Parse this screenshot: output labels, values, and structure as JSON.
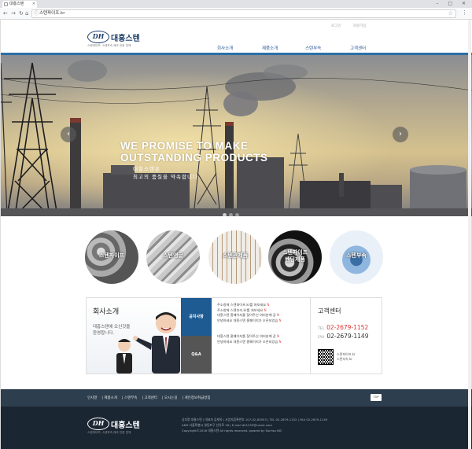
{
  "browser": {
    "tab_title": "대흥스텐",
    "url": "스텐파이프.kr",
    "window_controls": "– □ ✕"
  },
  "header": {
    "logo_mark": "DH",
    "logo_name": "대흥스텐",
    "logo_sub": "스텐파이프, 스텐부속 제조 전문 업체",
    "util_links": [
      "로그인",
      "회원가입"
    ],
    "nav": [
      "회사소개",
      "제품소개",
      "스텐부속",
      "고객센터"
    ]
  },
  "hero": {
    "title_line1": "WE PROMISE TO MAKE",
    "title_line2": "OUTSTANDING PRODUCTS",
    "sub_line1": "대흥스텐은",
    "sub_line2": "최고의 품질을 약속합니다",
    "slides": 3,
    "active_slide": 1
  },
  "categories": [
    "스텐파이프",
    "스텐앵글",
    "스텐관제품",
    "스텐파이프\n벤딩제품",
    "스텐부속"
  ],
  "about": {
    "title": "회사소개",
    "text_line1": "대흥스텐에 오신것을",
    "text_line2": "환영합니다."
  },
  "notice": {
    "tab_notice": "공지사항",
    "tab_qna": "Q&A",
    "notice_items": [
      "주소창에 스텐파이프.kr를 쳐보세요",
      "주소창에 스텐부속.kr를 쳐보세요",
      "대흥스텐 홈페이지를 찾아주신 여러분께 감",
      "안녕하세요 대흥스텐 홈페이지가 오픈되었습"
    ],
    "qna_items": [
      "대흥스텐 홈페이지를 찾아주신 여러분께 감",
      "안녕하세요 대흥스텐 홈페이지가 오픈되었습"
    ],
    "new_badge": "N"
  },
  "customer": {
    "title": "고객센터",
    "tel_label": "TEL",
    "tel": "02-2679-1152",
    "fax_label": "FAX",
    "fax": "02-2679-1149",
    "qr_line1": "스텐파이프.kr",
    "qr_line2": "스텐부속.kr"
  },
  "footer": {
    "links": [
      "인사말",
      "제품소개",
      "스텐부속",
      "고객센터",
      "오시는길",
      "개인정보취급방침"
    ],
    "top_button": "TOP",
    "info_line1": "상호명 대흥스텐 | 대표자 김재옥 | 사업자등록번호 107-02-83553 | TEL 02-2679-1152 | FAX 02-2679-1149",
    "info_line2": "ADD 서울특별시 영등포구 선유로 18 | E-mail dh1253@naver.com",
    "info_line3": "Copyright©2016 대흥스텐 All rights reserved. powerd by Sorriso INC"
  }
}
